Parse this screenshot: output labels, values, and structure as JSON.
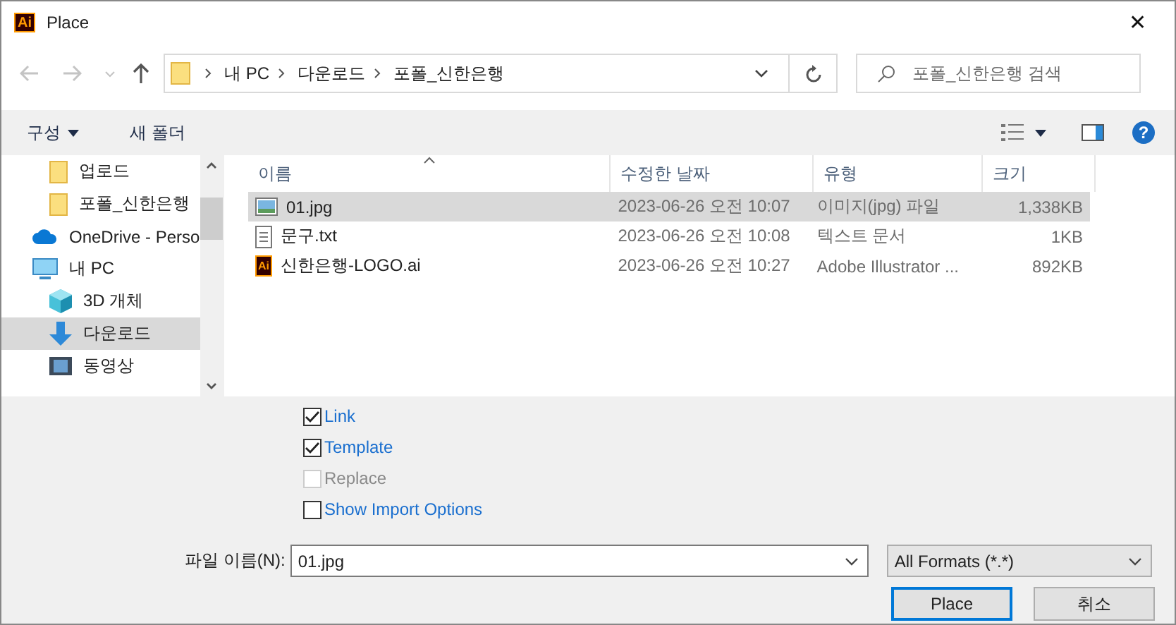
{
  "window": {
    "title": "Place",
    "close": "✕",
    "app_icon": "Ai"
  },
  "address": {
    "path": [
      "내 PC",
      "다운로드",
      "포폴_신한은행"
    ]
  },
  "search": {
    "placeholder": "포폴_신한은행 검색"
  },
  "toolbar": {
    "organize": "구성",
    "new_folder": "새 폴더",
    "help": "?"
  },
  "sidebar": {
    "items": [
      {
        "label": "업로드",
        "kind": "folder",
        "selected": false
      },
      {
        "label": "포폴_신한은행",
        "kind": "folder",
        "selected": false
      },
      {
        "label": "OneDrive - Perso",
        "kind": "cloud",
        "selected": false
      },
      {
        "label": "내 PC",
        "kind": "pc",
        "selected": false
      },
      {
        "label": "3D 개체",
        "kind": "cube",
        "selected": false
      },
      {
        "label": "다운로드",
        "kind": "download",
        "selected": true
      },
      {
        "label": "동영상",
        "kind": "video",
        "selected": false
      }
    ]
  },
  "table": {
    "columns": [
      "이름",
      "수정한 날짜",
      "유형",
      "크기"
    ],
    "rows": [
      {
        "name": "01.jpg",
        "kind": "image",
        "date": "2023-06-26 오전 10:07",
        "type": "이미지(jpg) 파일",
        "size": "1,338KB",
        "selected": true
      },
      {
        "name": "문구.txt",
        "kind": "text",
        "date": "2023-06-26 오전 10:08",
        "type": "텍스트 문서",
        "size": "1KB",
        "selected": false
      },
      {
        "name": "신한은행-LOGO.ai",
        "kind": "ai",
        "icon_text": "Ai",
        "date": "2023-06-26 오전 10:27",
        "type": "Adobe Illustrator ...",
        "size": "892KB",
        "selected": false
      }
    ]
  },
  "options": [
    {
      "label": "Link",
      "checked": true,
      "disabled": false
    },
    {
      "label": "Template",
      "checked": true,
      "disabled": false
    },
    {
      "label": "Replace",
      "checked": false,
      "disabled": true
    },
    {
      "label": "Show Import Options",
      "checked": false,
      "disabled": false
    }
  ],
  "file_name": {
    "label": "파일 이름(N):",
    "value": "01.jpg"
  },
  "file_type": {
    "value": "All Formats (*.*)"
  },
  "buttons": [
    "Place",
    "취소"
  ]
}
